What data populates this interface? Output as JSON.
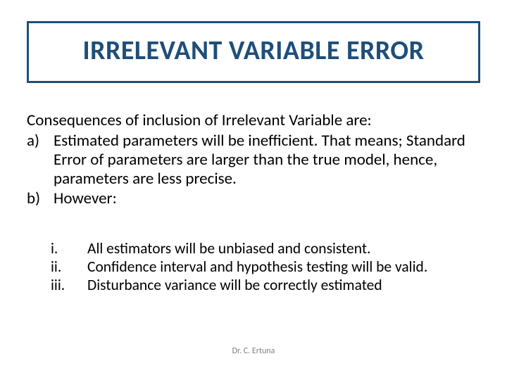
{
  "title": "IRRELEVANT VARIABLE  ERROR",
  "intro": "Consequences of inclusion of Irrelevant Variable are:",
  "points": {
    "a": {
      "marker": "a)",
      "text": "Estimated parameters will be inefficient. That means; Standard Error of parameters are larger than the true model, hence, parameters are less precise."
    },
    "b": {
      "marker": "b)",
      "text": "However:"
    }
  },
  "subpoints": {
    "i": {
      "marker": "i.",
      "text": "All estimators will be unbiased and consistent."
    },
    "ii": {
      "marker": "ii.",
      "text": "Confidence interval and hypothesis testing will be valid."
    },
    "iii": {
      "marker": "iii.",
      "text": "Disturbance variance will be correctly estimated"
    }
  },
  "footer": "Dr. C. Ertuna"
}
